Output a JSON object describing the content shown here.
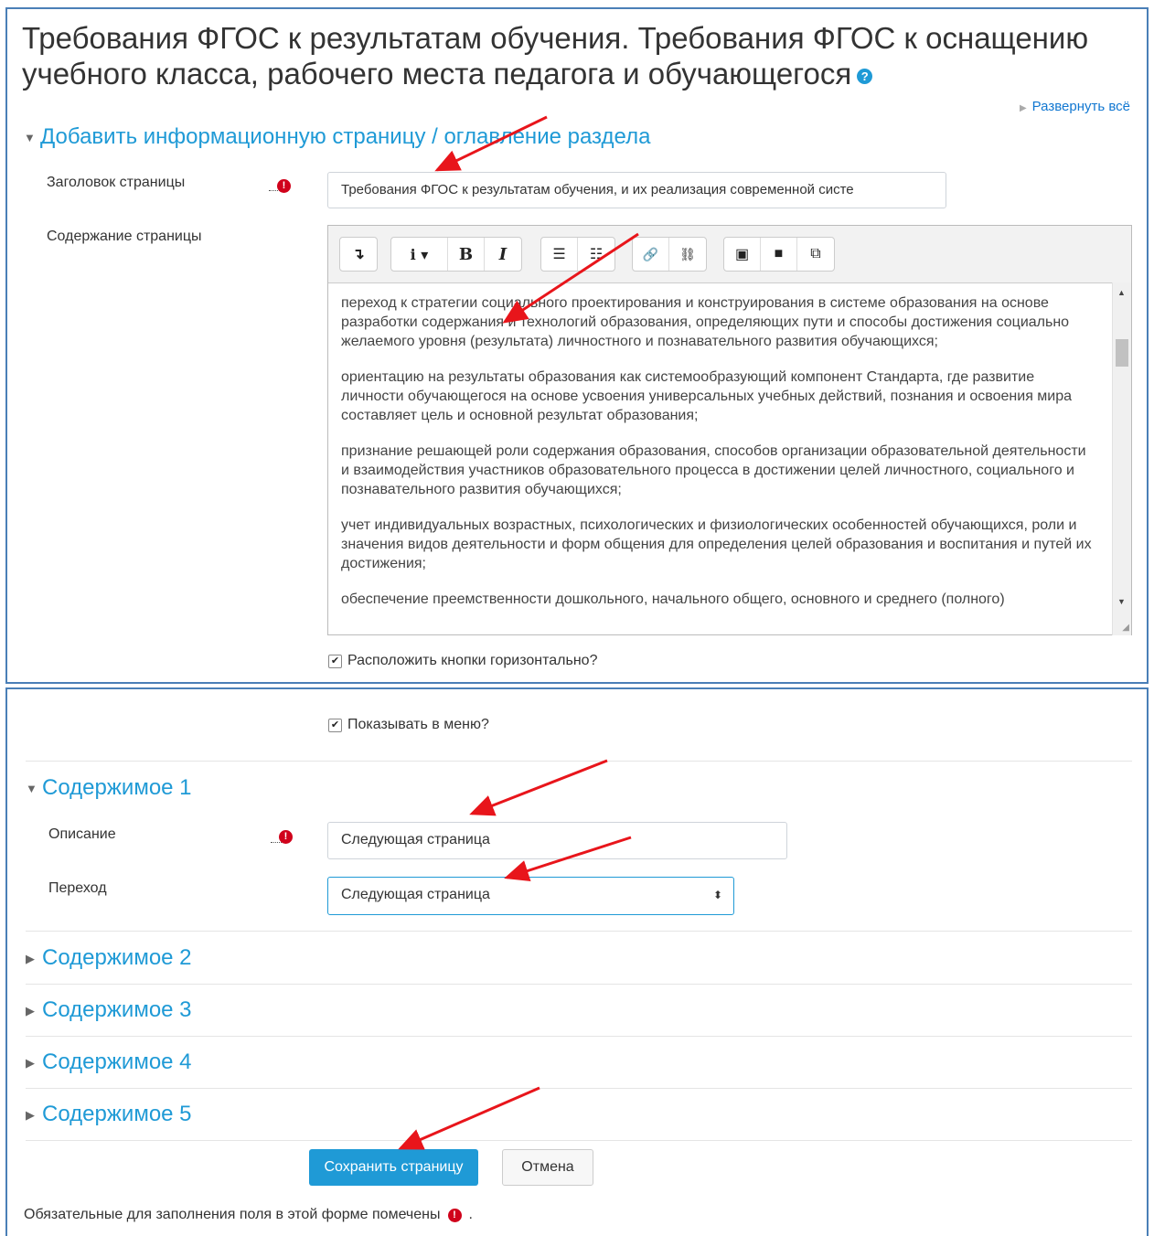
{
  "page": {
    "title": "Требования ФГОС к результатам обучения. Требования ФГОС к оснащению учебного класса, рабочего места педагога и обучающегося",
    "help_icon": "question-circle-icon",
    "expand_all": "Развернуть всё"
  },
  "section_main": {
    "title": "Добавить информационную страницу / оглавление раздела",
    "page_title_label": "Заголовок страницы",
    "page_title_value": "Требования ФГОС к результатам обучения, и их реализация современной систе",
    "content_label": "Содержание страницы",
    "toolbar": {
      "buttons": [
        "collapse",
        "info-style",
        "bold",
        "italic",
        "unordered-list",
        "ordered-list",
        "link",
        "unlink",
        "image",
        "media",
        "manage-files"
      ],
      "collapse_glyph": "↴",
      "style_glyph": "i ▾",
      "bold_glyph": "B",
      "italic_glyph": "I",
      "ul_glyph": "☰",
      "ol_glyph": "☷",
      "link_glyph": "🔗",
      "unlink_glyph": "⛓",
      "image_glyph": "▣",
      "video_glyph": "■",
      "files_glyph": "⧉"
    },
    "paragraphs": [
      "переход к стратегии социального проектирования и конструирования в системе образования на основе разработки содержания и технологий образования, определяющих пути и способы достижения социально желаемого уровня (результата) личностного и познавательного развития обучающихся;",
      "ориентацию на результаты образования как системообразующий компонент Стандарта, где развитие личности обучающегося на основе усвоения универсальных учебных действий,  познания и освоения мира составляет цель и основной результат образования;",
      "признание решающей роли содержания образования, способов организации  образовательной деятельности и взаимодействия участников образовательного процесса в достижении целей личностного, социального и познавательного развития обучающихся;",
      "учет индивидуальных возрастных, психологических и физиологических особенностей обучающихся, роли и значения видов деятельности и форм общения для определения целей образования и воспитания и путей их достижения;",
      "обеспечение преемственности дошкольного, начального общего, основного и среднего (полного)"
    ],
    "horizontal_buttons_label": "Расположить кнопки горизонтально?",
    "horizontal_buttons_checked": true
  },
  "section_menu": {
    "show_in_menu_label": "Показывать в меню?",
    "show_in_menu_checked": true
  },
  "content_sections": [
    {
      "title": "Содержимое 1",
      "expanded": true,
      "description_label": "Описание",
      "description_value": "Следующая страница",
      "jump_label": "Переход",
      "jump_value": "Следующая страница"
    },
    {
      "title": "Содержимое 2",
      "expanded": false
    },
    {
      "title": "Содержимое 3",
      "expanded": false
    },
    {
      "title": "Содержимое 4",
      "expanded": false
    },
    {
      "title": "Содержимое 5",
      "expanded": false
    }
  ],
  "buttons": {
    "save": "Сохранить страницу",
    "cancel": "Отмена"
  },
  "footer": {
    "required_note": "Обязательные для заполнения поля в этой форме помечены",
    "required_note_end": "."
  },
  "colors": {
    "accent": "#1f9ad6",
    "required": "#d0021b",
    "panel_border": "#4a7fb7",
    "annotation_arrow": "#e8151b"
  }
}
